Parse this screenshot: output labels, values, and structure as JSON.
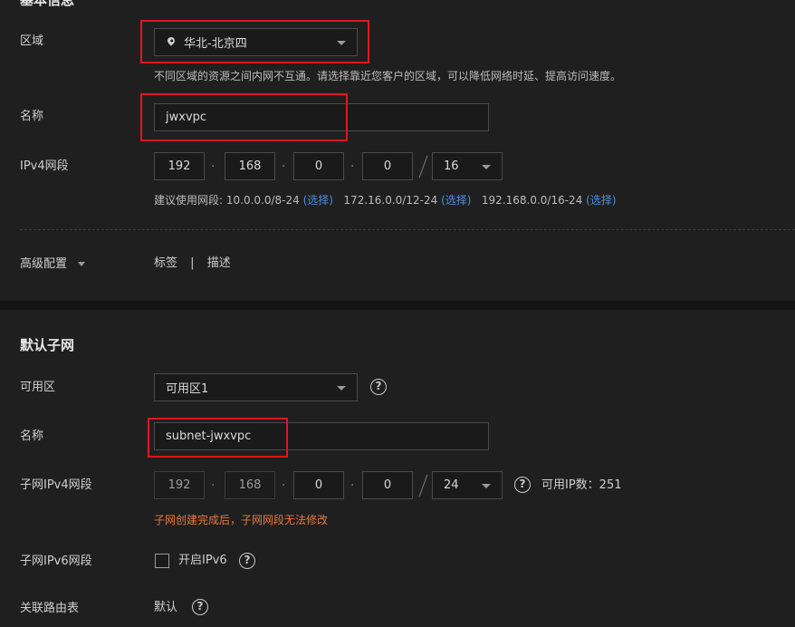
{
  "basic": {
    "title": "基本信息",
    "region": {
      "label": "区域",
      "value": "华北-北京四",
      "hint": "不同区域的资源之间内网不互通。请选择靠近您客户的区域，可以降低网络时延、提高访问速度。"
    },
    "name": {
      "label": "名称",
      "value": "jwxvpc"
    },
    "ipv4": {
      "label": "IPv4网段",
      "octets": [
        "192",
        "168",
        "0",
        "0"
      ],
      "mask": "16",
      "suggest_prefix": "建议使用网段: 10.0.0.0/8-24",
      "suggest_2": "172.16.0.0/12-24",
      "suggest_3": "192.168.0.0/16-24",
      "choose": "(选择)"
    },
    "advanced": {
      "label": "高级配置",
      "tag": "标签",
      "sep": "|",
      "desc": "描述"
    }
  },
  "subnet": {
    "title": "默认子网",
    "az": {
      "label": "可用区",
      "value": "可用区1"
    },
    "name": {
      "label": "名称",
      "value": "subnet-jwxvpc"
    },
    "ipv4": {
      "label": "子网IPv4网段",
      "octets": [
        "192",
        "168",
        "0",
        "0"
      ],
      "mask": "24",
      "available": "可用IP数：251",
      "warning": "子网创建完成后，子网网段无法修改"
    },
    "ipv6": {
      "label": "子网IPv6网段",
      "checkbox_label": "开启IPv6"
    },
    "route": {
      "label": "关联路由表",
      "value": "默认"
    }
  },
  "icons": {
    "help": "?",
    "location": "location-pin-icon",
    "caret": "caret-down-icon"
  },
  "colors": {
    "highlight": "#e0161f",
    "link": "#4a90e2",
    "warning": "#e8793a"
  }
}
